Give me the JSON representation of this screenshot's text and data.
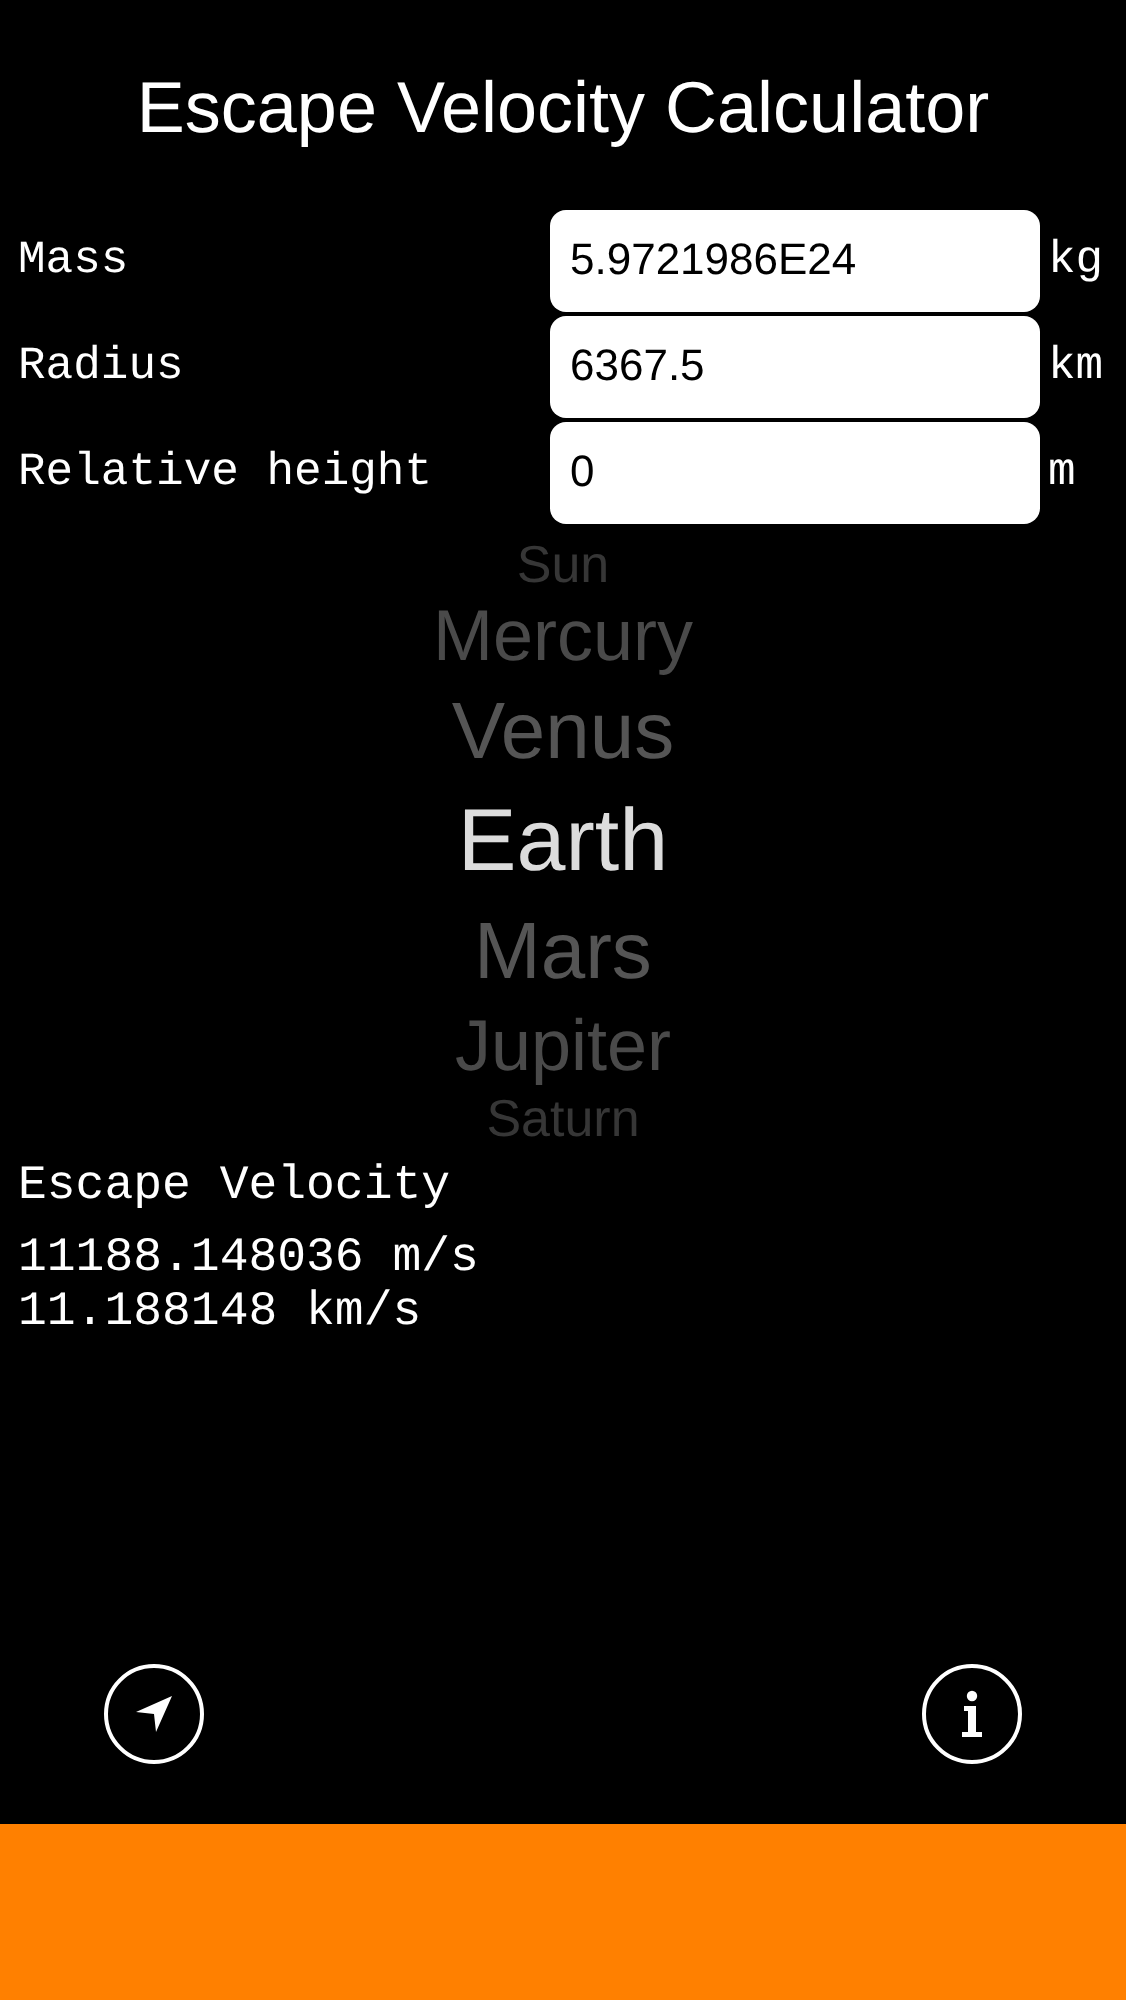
{
  "title": "Escape Velocity Calculator",
  "fields": [
    {
      "label": "Mass",
      "value": "5.9721986E24",
      "unit": "kg"
    },
    {
      "label": "Radius",
      "value": "6367.5",
      "unit": "km"
    },
    {
      "label": "Relative height",
      "value": "0",
      "unit": "m"
    }
  ],
  "picker": [
    {
      "label": "Sun",
      "selected": false
    },
    {
      "label": "Mercury",
      "selected": false
    },
    {
      "label": "Venus",
      "selected": false
    },
    {
      "label": "Earth",
      "selected": true
    },
    {
      "label": "Mars",
      "selected": false
    },
    {
      "label": "Jupiter",
      "selected": false
    },
    {
      "label": "Saturn",
      "selected": false
    }
  ],
  "result": {
    "label": "Escape Velocity",
    "lines": [
      "11188.148036 m/s",
      "11.188148 km/s"
    ]
  }
}
